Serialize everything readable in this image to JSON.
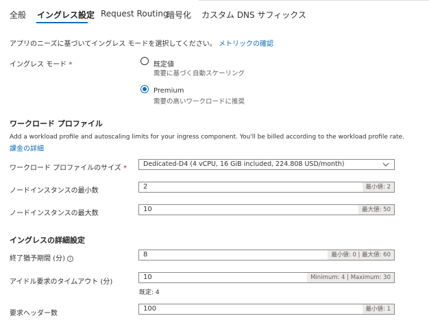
{
  "tabs": [
    {
      "label": "全般"
    },
    {
      "label": "イングレス設定"
    },
    {
      "label": "Request Routing"
    },
    {
      "label": "暗号化"
    },
    {
      "label": "カスタム DNS サフィックス"
    }
  ],
  "intro": {
    "text": "アプリのニーズに基づいてイングレス モードを選択してください。",
    "link": "メトリックの確認"
  },
  "ingress_mode": {
    "label": "イングレス モード",
    "required": "*",
    "options": [
      {
        "title": "既定値",
        "desc": "需要に基づく自動スケーリング",
        "checked": false
      },
      {
        "title": "Premium",
        "desc": "需要の高いワークロードに推奨",
        "checked": true
      }
    ]
  },
  "workload_profile": {
    "heading": "ワークロード プロファイル",
    "description": "Add a workload profile and autoscaling limits for your ingress component. You'll be billed according to the workload profile rate.",
    "billing_link": "課金の詳細",
    "size": {
      "label": "ワークロード プロファイルのサイズ",
      "required": "*",
      "value": "Dedicated-D4 (4 vCPU, 16 GiB included, 224.808 USD/month)"
    },
    "min_nodes": {
      "label": "ノードインスタンスの最小数",
      "value": "2",
      "hint": "最小値: 2"
    },
    "max_nodes": {
      "label": "ノードインスタンスの最大数",
      "value": "10",
      "hint": "最大値: 50"
    }
  },
  "advanced": {
    "heading": "イングレスの詳細設定",
    "termination": {
      "label": "終了猶予期間 (分)",
      "info": "i",
      "value": "8",
      "hint": "最小値: 0 | 最大値: 60"
    },
    "idle_timeout": {
      "label": "アイドル要求のタイムアウト (分)",
      "value": "10",
      "hint": "Minimum: 4 | Maximum: 30",
      "default_note": "既定: 4"
    },
    "header_count": {
      "label": "要求ヘッダー数",
      "value": "100",
      "hint": "最小値: 1"
    }
  }
}
